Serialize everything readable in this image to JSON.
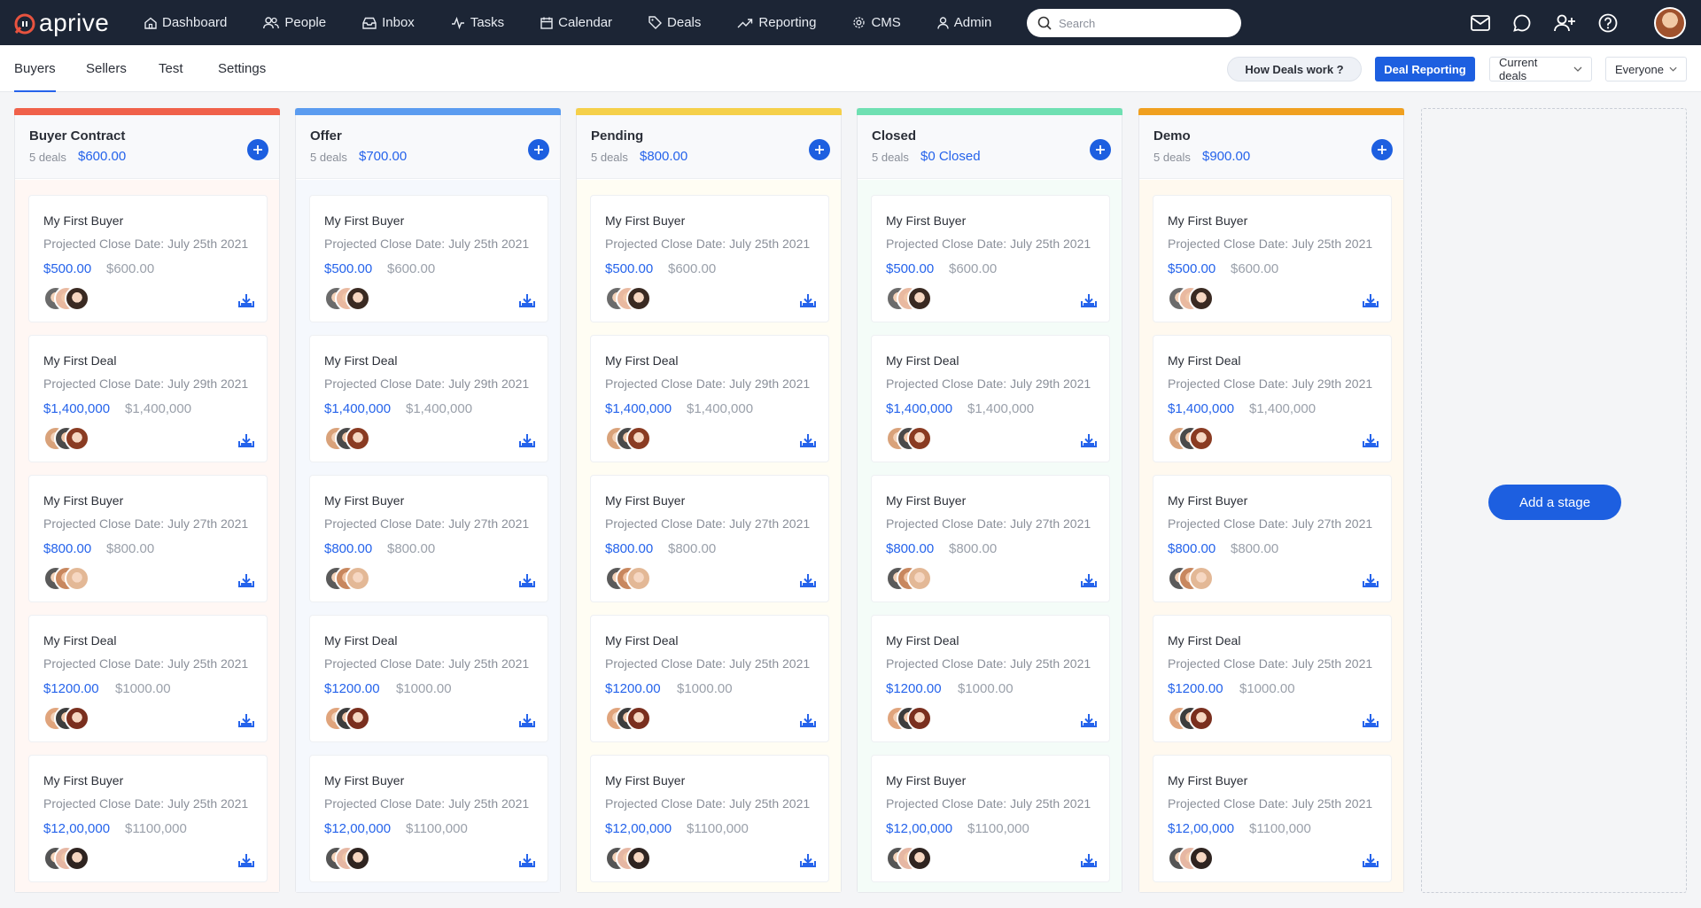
{
  "brand": {
    "logo_text": "aprive",
    "accent": "#1d5fe0",
    "logo_color": "#e8533f"
  },
  "nav": {
    "items": [
      {
        "label": "Dashboard",
        "icon": "home-icon"
      },
      {
        "label": "People",
        "icon": "people-icon"
      },
      {
        "label": "Inbox",
        "icon": "inbox-icon"
      },
      {
        "label": "Tasks",
        "icon": "activity-icon"
      },
      {
        "label": "Calendar",
        "icon": "calendar-icon"
      },
      {
        "label": "Deals",
        "icon": "tag-icon"
      },
      {
        "label": "Reporting",
        "icon": "trend-icon"
      },
      {
        "label": "CMS",
        "icon": "gear-icon"
      },
      {
        "label": "Admin",
        "icon": "user-icon"
      }
    ],
    "search_placeholder": "Search"
  },
  "subnav": {
    "tabs": [
      {
        "label": "Buyers",
        "active": true
      },
      {
        "label": "Sellers",
        "active": false
      },
      {
        "label": "Test",
        "active": false
      },
      {
        "label": "Settings",
        "active": false
      }
    ],
    "how_deals_work": "How Deals work ?",
    "deal_reporting": "Deal Reporting",
    "filter_deals": "Current deals",
    "filter_owner": "Everyone"
  },
  "cards_template": [
    {
      "title": "My First Buyer",
      "date": "Projected Close Date: July 25th 2021",
      "value": "$500.00",
      "expected": "$600.00"
    },
    {
      "title": "My First Deal",
      "date": "Projected Close Date: July 29th 2021",
      "value": "$1,400,000",
      "expected": "$1,400,000"
    },
    {
      "title": "My First Buyer",
      "date": "Projected Close Date: July 27th 2021",
      "value": "$800.00",
      "expected": "$800.00"
    },
    {
      "title": "My First Deal",
      "date": "Projected Close Date: July 25th 2021",
      "value": "$1200.00",
      "expected": "$1000.00"
    },
    {
      "title": "My First Buyer",
      "date": "Projected Close Date: July 25th 2021",
      "value": "$12,00,000",
      "expected": "$1100,000"
    }
  ],
  "stages": [
    {
      "name": "Buyer Contract",
      "count": "5 deals",
      "amount": "$600.00",
      "color": "#f0614a",
      "bg": "#fff7f4"
    },
    {
      "name": "Offer",
      "count": "5 deals",
      "amount": "$700.00",
      "color": "#5b9cf0",
      "bg": "#f5f8fd"
    },
    {
      "name": "Pending",
      "count": "5 deals",
      "amount": "$800.00",
      "color": "#f5d04a",
      "bg": "#fffdf3"
    },
    {
      "name": "Closed",
      "count": "5 deals",
      "amount": "$0 Closed",
      "color": "#6fe0b2",
      "bg": "#f4fcf8"
    },
    {
      "name": "Demo",
      "count": "5 deals",
      "amount": "$900.00",
      "color": "#f0a020",
      "bg": "#fff9ef"
    }
  ],
  "add_stage": "Add a stage"
}
